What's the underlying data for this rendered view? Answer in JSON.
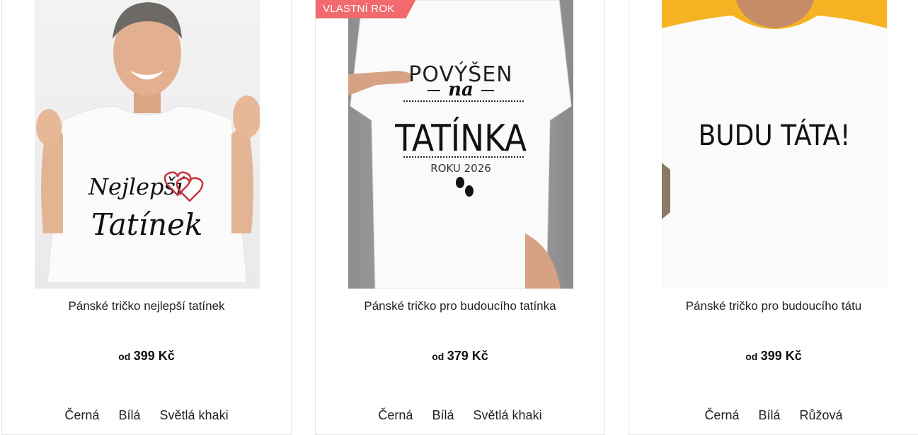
{
  "products": [
    {
      "badge": "",
      "title": "Pánské tričko nejlepší tatínek",
      "price_prefix": "od",
      "price": "399 Kč",
      "print_lines": [
        "Nejlepší",
        "Tatínek"
      ],
      "colors": [
        "Černá",
        "Bílá",
        "Světlá khaki"
      ]
    },
    {
      "badge": "VLASTNÍ ROK",
      "title": "Pánské tričko pro budoucího tatínka",
      "price_prefix": "od",
      "price": "379 Kč",
      "print_lines": [
        "POVÝŠEN",
        "na",
        "TATÍNKA",
        "ROKU 2026"
      ],
      "colors": [
        "Černá",
        "Bílá",
        "Světlá khaki"
      ]
    },
    {
      "badge": "",
      "title": "Pánské tričko pro budoucího tátu",
      "price_prefix": "od",
      "price": "399 Kč",
      "print_lines": [
        "BUDU TÁTA!"
      ],
      "colors": [
        "Černá",
        "Bílá",
        "Růžová"
      ]
    }
  ],
  "colors": {
    "badge_bg": "#f06a6e",
    "heart": "#c8323c",
    "border": "#e6e6e6",
    "card3_background": "#f5b323"
  }
}
